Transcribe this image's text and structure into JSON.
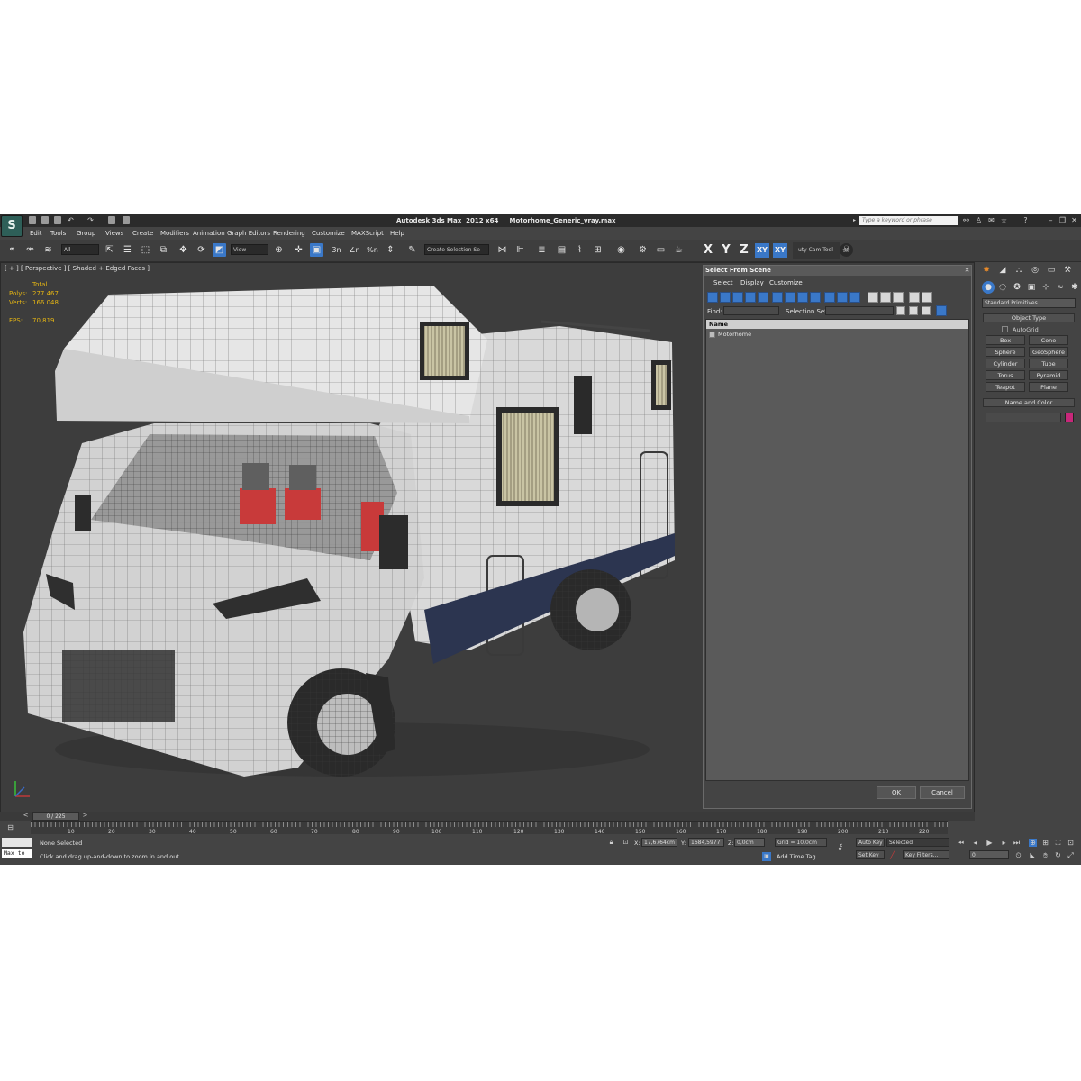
{
  "window": {
    "title": "Autodesk 3ds Max  2012 x64     Motorhome_Generic_vray.max",
    "search_placeholder": "Type a keyword or phrase",
    "logo_glyph": "S"
  },
  "menu": [
    "Edit",
    "Tools",
    "Group",
    "Views",
    "Create",
    "Modifiers",
    "Animation",
    "Graph Editors",
    "Rendering",
    "Customize",
    "MAXScript",
    "Help"
  ],
  "toolbar": {
    "selection_filter": "All",
    "coord_system": "View",
    "create_selection_set": "Create Selection Se",
    "snap_labels": [
      "3n",
      "∠n",
      "%n"
    ],
    "axis_buttons": [
      "X",
      "Y",
      "Z",
      "XY",
      "XY"
    ],
    "tool_name": "uty Cam Tool"
  },
  "viewport": {
    "label": "[ + ] [ Perspective ] [ Shaded + Edged Faces ]",
    "stats": {
      "total_label": "Total",
      "polys_label": "Polys:",
      "polys": "277 467",
      "verts_label": "Verts:",
      "verts": "166 048",
      "fps_label": "FPS:",
      "fps": "70,819"
    }
  },
  "dialog": {
    "title": "Select From Scene",
    "menu": [
      "Select",
      "Display",
      "Customize"
    ],
    "find_label": "Find:",
    "selection_set_label": "Selection Set:",
    "column_name": "Name",
    "items": [
      "Motorhome"
    ],
    "ok": "OK",
    "cancel": "Cancel"
  },
  "command_panel": {
    "category": "Standard Primitives",
    "object_type": "Object Type",
    "autogrid": "AutoGrid",
    "primitives": [
      "Box",
      "Cone",
      "Sphere",
      "GeoSphere",
      "Cylinder",
      "Tube",
      "Torus",
      "Pyramid",
      "Teapot",
      "Plane"
    ],
    "name_and_color": "Name and Color",
    "object_color": "#c8277a"
  },
  "timeline": {
    "slider": "0 / 225",
    "ticks": [
      "10",
      "20",
      "30",
      "40",
      "50",
      "60",
      "70",
      "80",
      "90",
      "100",
      "110",
      "120",
      "130",
      "140",
      "150",
      "160",
      "170",
      "180",
      "190",
      "200",
      "210",
      "220"
    ]
  },
  "status": {
    "maxscript_listener": "Max to",
    "selection": "None Selected",
    "prompt": "Click and drag up-and-down to zoom in and out",
    "x_label": "X:",
    "x": "17,6764cm",
    "y_label": "Y:",
    "y": "1684,5977",
    "z_label": "Z:",
    "z": "0,0cm",
    "grid": "Grid = 10,0cm",
    "add_time_tag": "Add Time Tag",
    "auto_key": "Auto Key",
    "set_key": "Set Key",
    "key_mode": "Selected",
    "key_filters": "Key Filters...",
    "frame": "0"
  }
}
